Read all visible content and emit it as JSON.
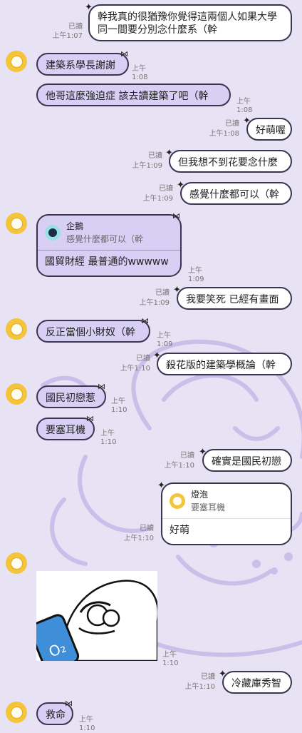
{
  "messages": [
    {
      "text": "幹我真的很猶豫你覺得這兩個人如果大學同一間要分別念什麼系（幹",
      "read": "已讀",
      "time": "上午1:07"
    },
    {
      "text": "建築系學長謝謝",
      "time": "上午1:08"
    },
    {
      "text": "他哥這麼強迫症 該去讀建築了吧（幹",
      "time": "上午1:08"
    },
    {
      "text": "好萌喔",
      "read": "已讀",
      "time": "上午1:08"
    },
    {
      "text": "但我想不到花要念什麼",
      "read": "已讀",
      "time": "上午1:09"
    },
    {
      "text": "感覺什麼都可以（幹",
      "read": "已讀",
      "time": "上午1:09"
    },
    {
      "reply_name": "企鵝",
      "reply_text": "感覺什麼都可以（幹",
      "text": "國貿財經 最普通的wwwww",
      "time": "上午1:09"
    },
    {
      "text": "我要笑死 已經有畫面",
      "read": "已讀",
      "time": "上午1:09"
    },
    {
      "text": "反正當個小財奴（幹",
      "time": "上午1:09"
    },
    {
      "text": "殺花版的建築學概論（幹",
      "read": "已讀",
      "time": "上午1:10"
    },
    {
      "text": "國民初戀惹",
      "time": "上午1:10"
    },
    {
      "text": "要塞耳機",
      "time": "上午1:10"
    },
    {
      "text": "確實是國民初戀",
      "read": "已讀",
      "time": "上午1:10"
    },
    {
      "reply_name": "燈泡",
      "reply_text": "要塞耳機",
      "text": "好萌",
      "read": "已讀",
      "time": "上午1:10"
    },
    {
      "sticker": "o2-sticker",
      "sticker_label": "O₂",
      "time": "上午1:10"
    },
    {
      "text": "冷藏庫秀智",
      "read": "已讀",
      "time": "上午1:10"
    },
    {
      "text": "救命",
      "time": "上午1:10"
    }
  ],
  "colors": {
    "background": "#e7e2f4",
    "incoming": "#d8cff5",
    "outgoing": "#ffffff",
    "avatar": "#f4c43a"
  }
}
